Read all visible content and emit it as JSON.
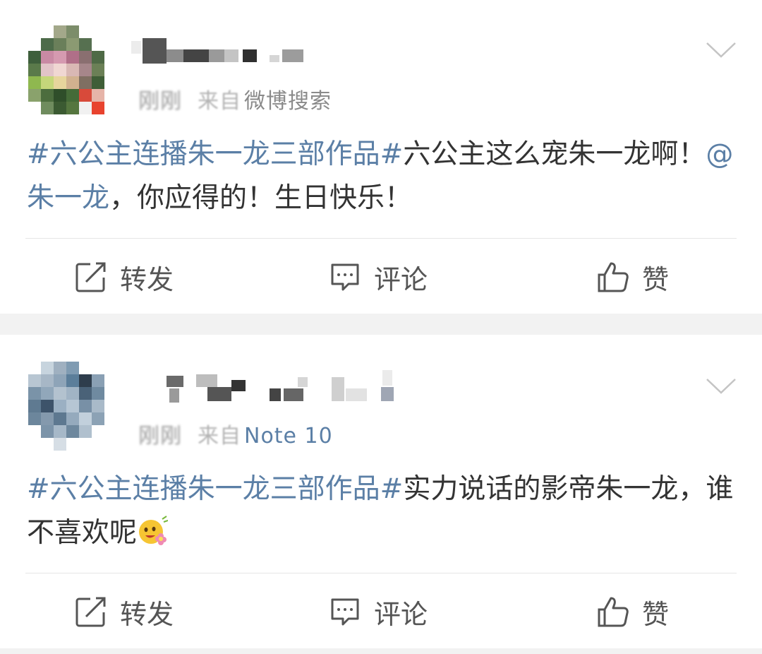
{
  "posts": [
    {
      "time": "刚刚",
      "source_prefix": "来自",
      "source": "微博搜索",
      "hashtag": "#六公主连播朱一龙三部作品#",
      "text_before_mention": "六公主这么宠朱一龙啊！",
      "mention": "@朱一龙",
      "text_after_mention": "，你应得的！生日快乐！",
      "actions": {
        "repost": "转发",
        "comment": "评论",
        "like": "赞"
      }
    },
    {
      "time": "刚刚",
      "source_prefix": "来自",
      "source": "Note 10",
      "hashtag": "#六公主连播朱一龙三部作品#",
      "text": "实力说话的影帝朱一龙，谁不喜欢呢",
      "emoji": "flower-smile-emoji",
      "actions": {
        "repost": "转发",
        "comment": "评论",
        "like": "赞"
      }
    }
  ],
  "colors": {
    "link": "#5b7fa6",
    "text": "#333333",
    "meta": "#b3b3b3",
    "background": "#f2f2f2"
  },
  "icons": [
    "chevron-down-icon",
    "repost-icon",
    "comment-icon",
    "like-icon"
  ]
}
